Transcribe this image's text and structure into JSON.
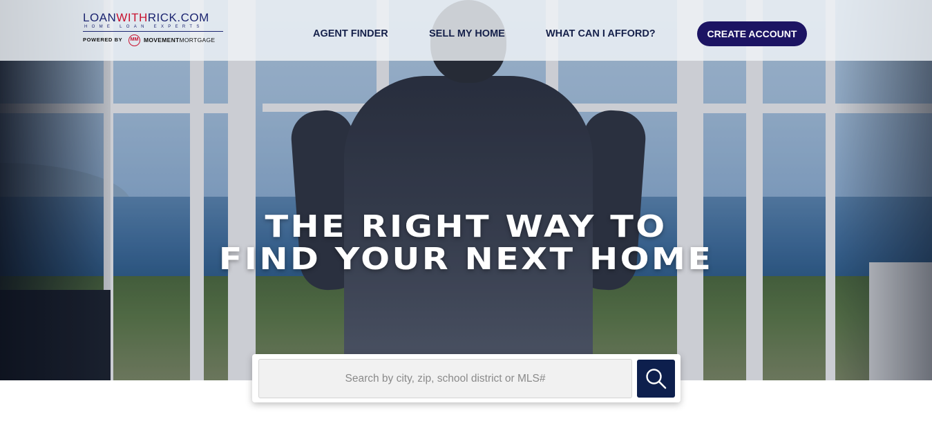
{
  "header": {
    "logo": {
      "main_part1": "LOAN",
      "main_part2": "WITH",
      "main_part3": "RICK",
      "main_part4": ".COM",
      "tagline": "HOME LOAN EXPERTS",
      "powered_by": "POWERED BY",
      "badge": "MM",
      "partner_bold": "MOVEMENT",
      "partner_rest": "MORTGAGE"
    },
    "nav": {
      "agent_finder": "AGENT FINDER",
      "sell_my_home": "SELL MY HOME",
      "what_can_i_afford": "WHAT CAN I AFFORD?"
    },
    "create_account": "CREATE ACCOUNT"
  },
  "hero": {
    "headline_line1": "THE RIGHT WAY TO",
    "headline_line2": "FIND YOUR NEXT HOME"
  },
  "search": {
    "placeholder": "Search by city, zip, school district or MLS#",
    "value": "",
    "button_icon": "search-icon"
  },
  "colors": {
    "brand_navy": "#1c1463",
    "brand_red": "#c8102e",
    "search_button": "#0d1f4d",
    "nav_text": "#15204a"
  }
}
